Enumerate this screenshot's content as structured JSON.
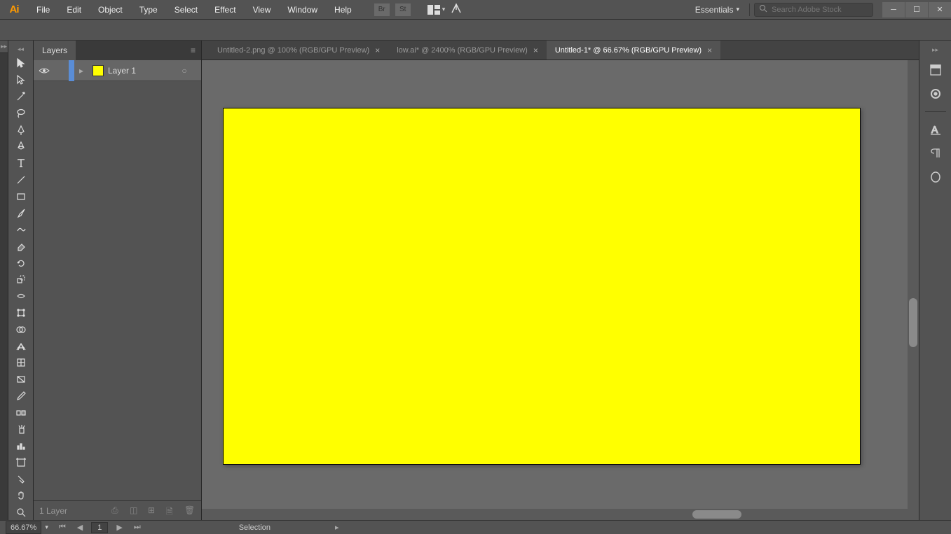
{
  "app": {
    "name": "Ai"
  },
  "menu": [
    "File",
    "Edit",
    "Object",
    "Type",
    "Select",
    "Effect",
    "View",
    "Window",
    "Help"
  ],
  "workspace": "Essentials",
  "search": {
    "placeholder": "Search Adobe Stock"
  },
  "doc_tabs": [
    {
      "label": "Untitled-2.png @ 100% (RGB/GPU Preview)",
      "active": false
    },
    {
      "label": "low.ai* @ 2400% (RGB/GPU Preview)",
      "active": false
    },
    {
      "label": "Untitled-1* @ 66.67% (RGB/GPU Preview)",
      "active": true
    }
  ],
  "layers": {
    "panel_title": "Layers",
    "items": [
      {
        "name": "Layer 1",
        "swatch": "#ffff00"
      }
    ],
    "footer_count": "1 Layer"
  },
  "status": {
    "zoom": "66.67%",
    "page": "1",
    "tool": "Selection"
  },
  "menu_icon_labels": {
    "br": "Br",
    "st": "St"
  }
}
